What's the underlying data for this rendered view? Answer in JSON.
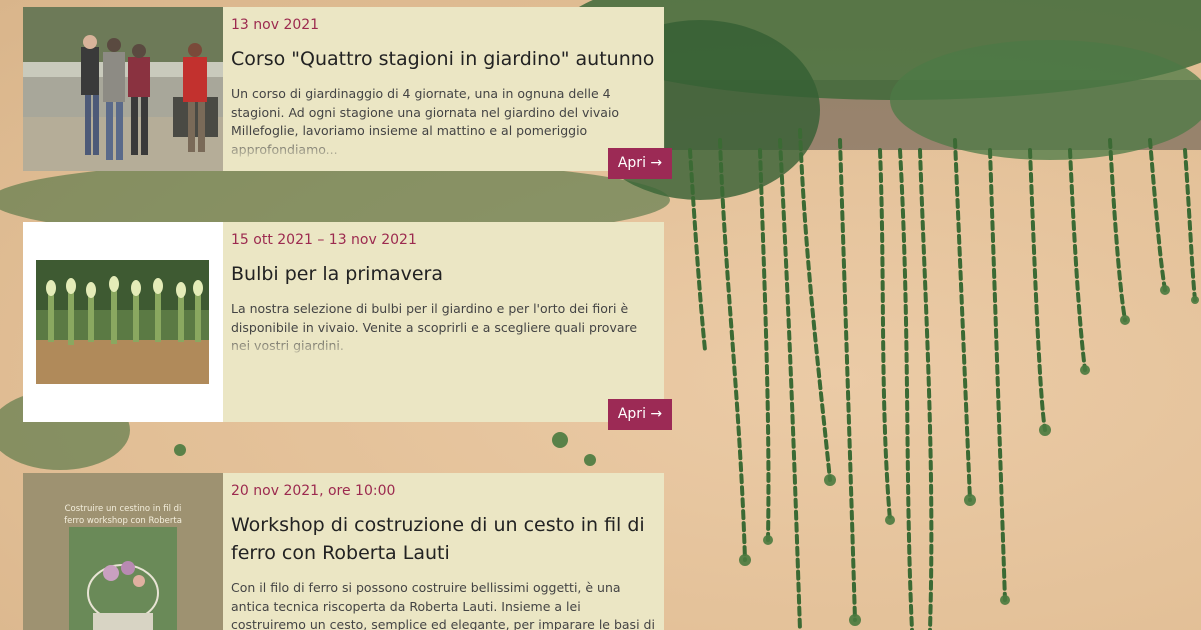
{
  "events": [
    {
      "date": "13 nov 2021",
      "title": "Corso \"Quattro stagioni in giardino\" autunno",
      "excerpt": "Un corso di giardinaggio di 4 giornate, una in ognuna delle 4 stagioni. Ad ogni stagione una giornata nel giardino del vivaio Millefoglie, lavoriamo insieme al mattino e al pomeriggio approfondiamo...",
      "button": "Apri →"
    },
    {
      "date": "15 ott 2021 – 13 nov 2021",
      "title": "Bulbi per la primavera",
      "excerpt": "La nostra selezione di bulbi per il giardino e per l'orto dei fiori è disponibile in vivaio. Venite a scoprirli e a scegliere quali provare nei vostri giardini.",
      "button": "Apri →"
    },
    {
      "date": "20 nov 2021, ore 10:00",
      "title": "Workshop di costruzione di un cesto in fil di ferro con Roberta Lauti",
      "excerpt": "Con il filo di ferro si possono costruire bellissimi oggetti, è una antica tecnica riscoperta da Roberta Lauti. Insieme a lei costruiremo un cesto, semplice ed elegante, per imparare le basi di que...",
      "poster_text": "Costruire un cestino in fil di ferro workshop con Roberta Lauti"
    }
  ],
  "colors": {
    "accent": "#9c2a55",
    "card_bg": "#ebe6c4",
    "wall": "#e6c49c"
  }
}
